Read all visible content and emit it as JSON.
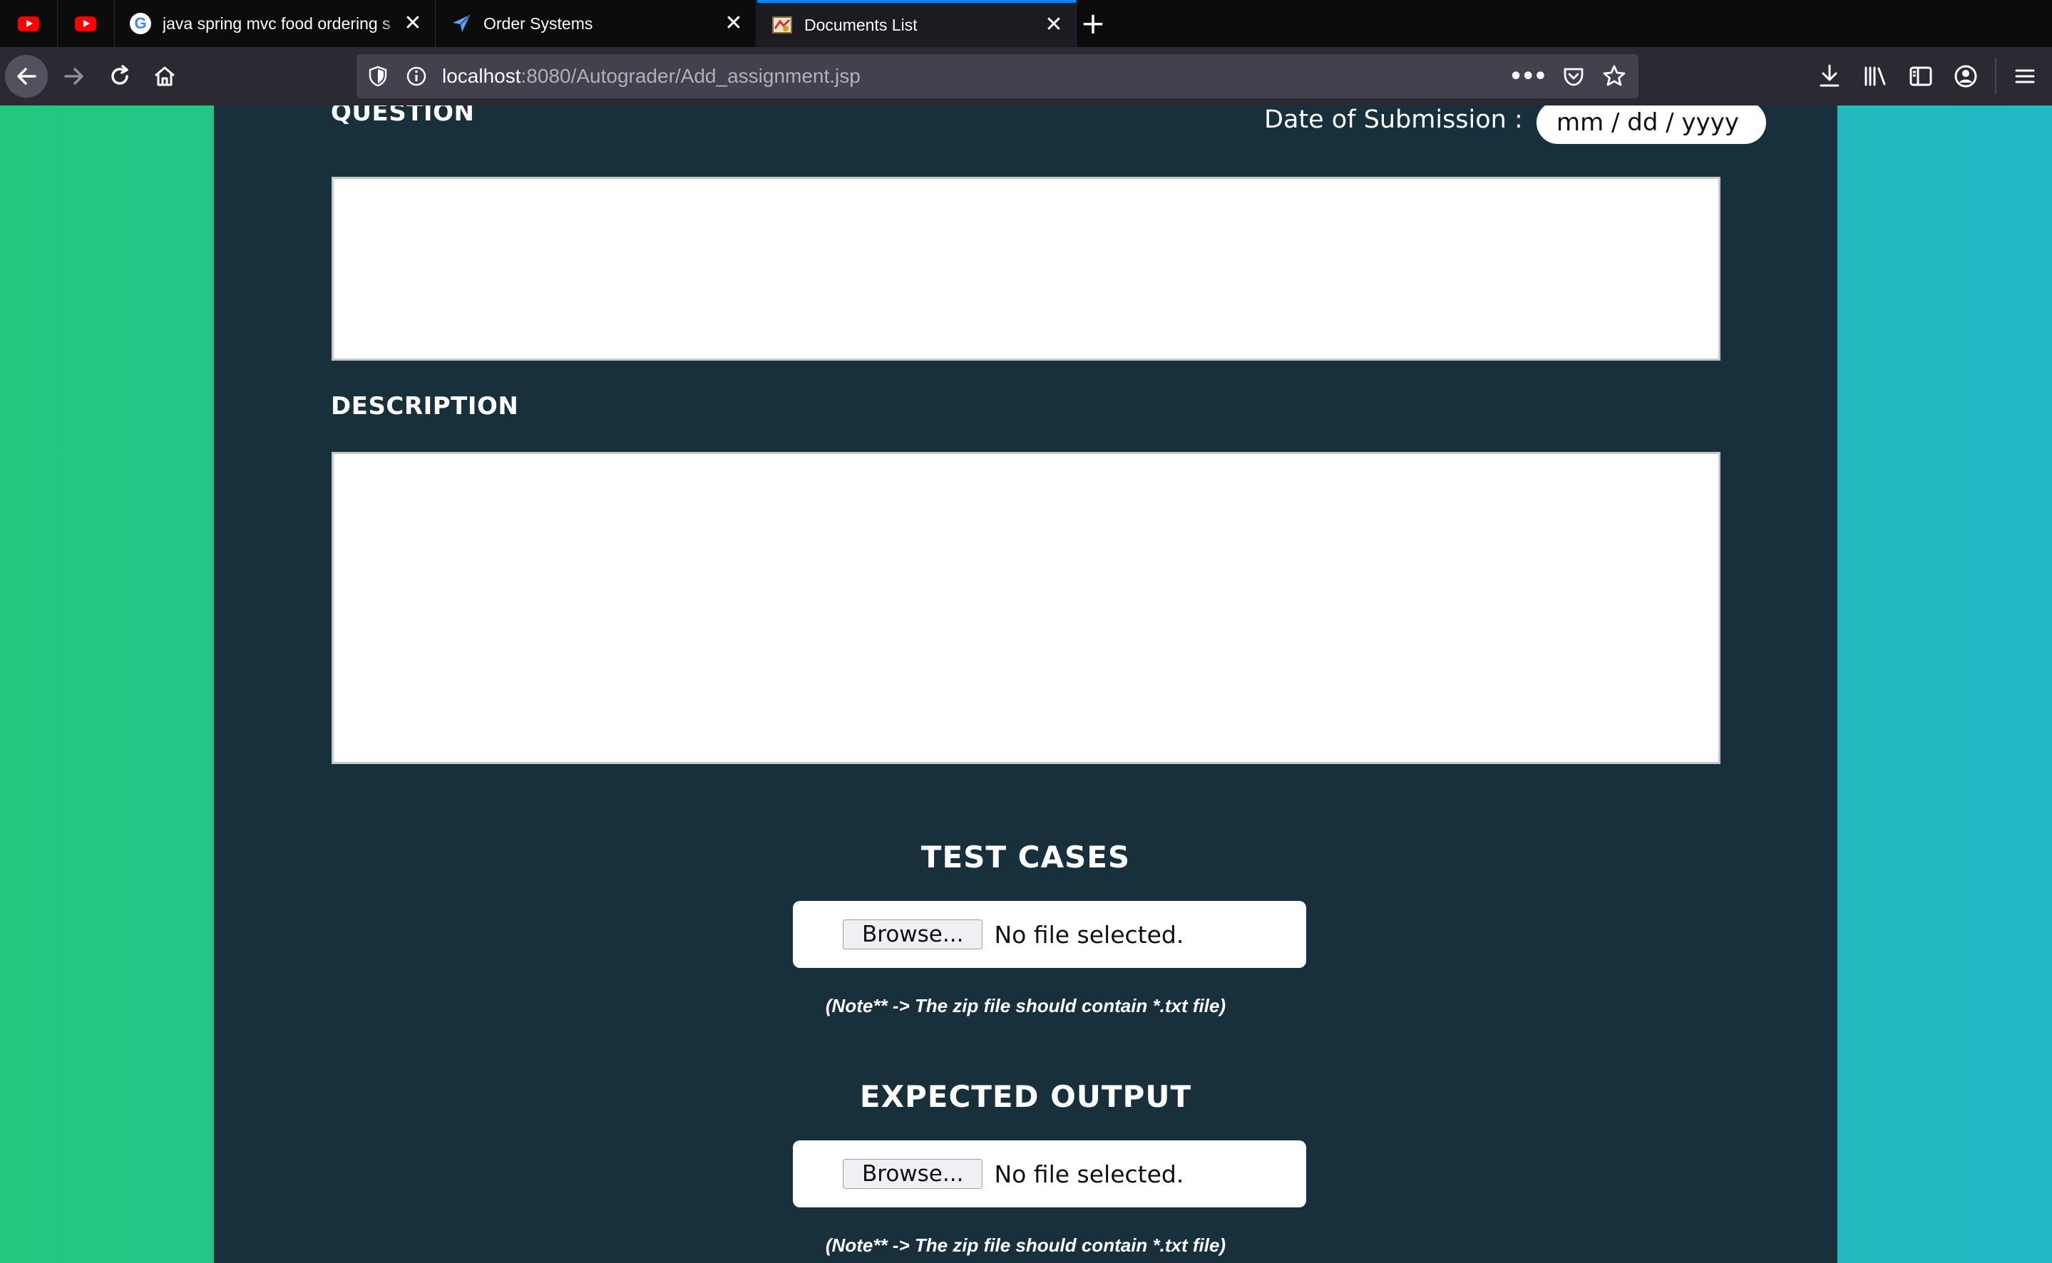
{
  "browser": {
    "tabs": [
      {
        "title": "java spring mvc food ordering s",
        "favicon": "google-icon"
      },
      {
        "title": "Order Systems",
        "favicon": "send-icon"
      },
      {
        "title": "Documents List",
        "favicon": "folder-icon"
      }
    ],
    "pinned_tabs": [
      "youtube-icon",
      "youtube-icon"
    ],
    "url": {
      "host": "localhost",
      "path": ":8080/Autograder/Add_assignment.jsp"
    },
    "accent_color": "#0a84ff"
  },
  "form": {
    "question_label": "QUESTION",
    "date_label": "Date of Submission :",
    "date_placeholder": "mm / dd / yyyy",
    "description_label": "DESCRIPTION",
    "test_cases": {
      "heading": "TEST CASES",
      "browse_label": "Browse...",
      "status": "No file selected.",
      "note": "(Note** -> The zip file should contain *.txt file)"
    },
    "expected_output": {
      "heading": "EXPECTED OUTPUT",
      "browse_label": "Browse...",
      "status": "No file selected.",
      "note": "(Note** -> The zip file should contain *.txt file)"
    },
    "colors": {
      "panel": "#17303b",
      "gradient_left": "#23c77f",
      "gradient_right": "#22b8c5"
    }
  }
}
